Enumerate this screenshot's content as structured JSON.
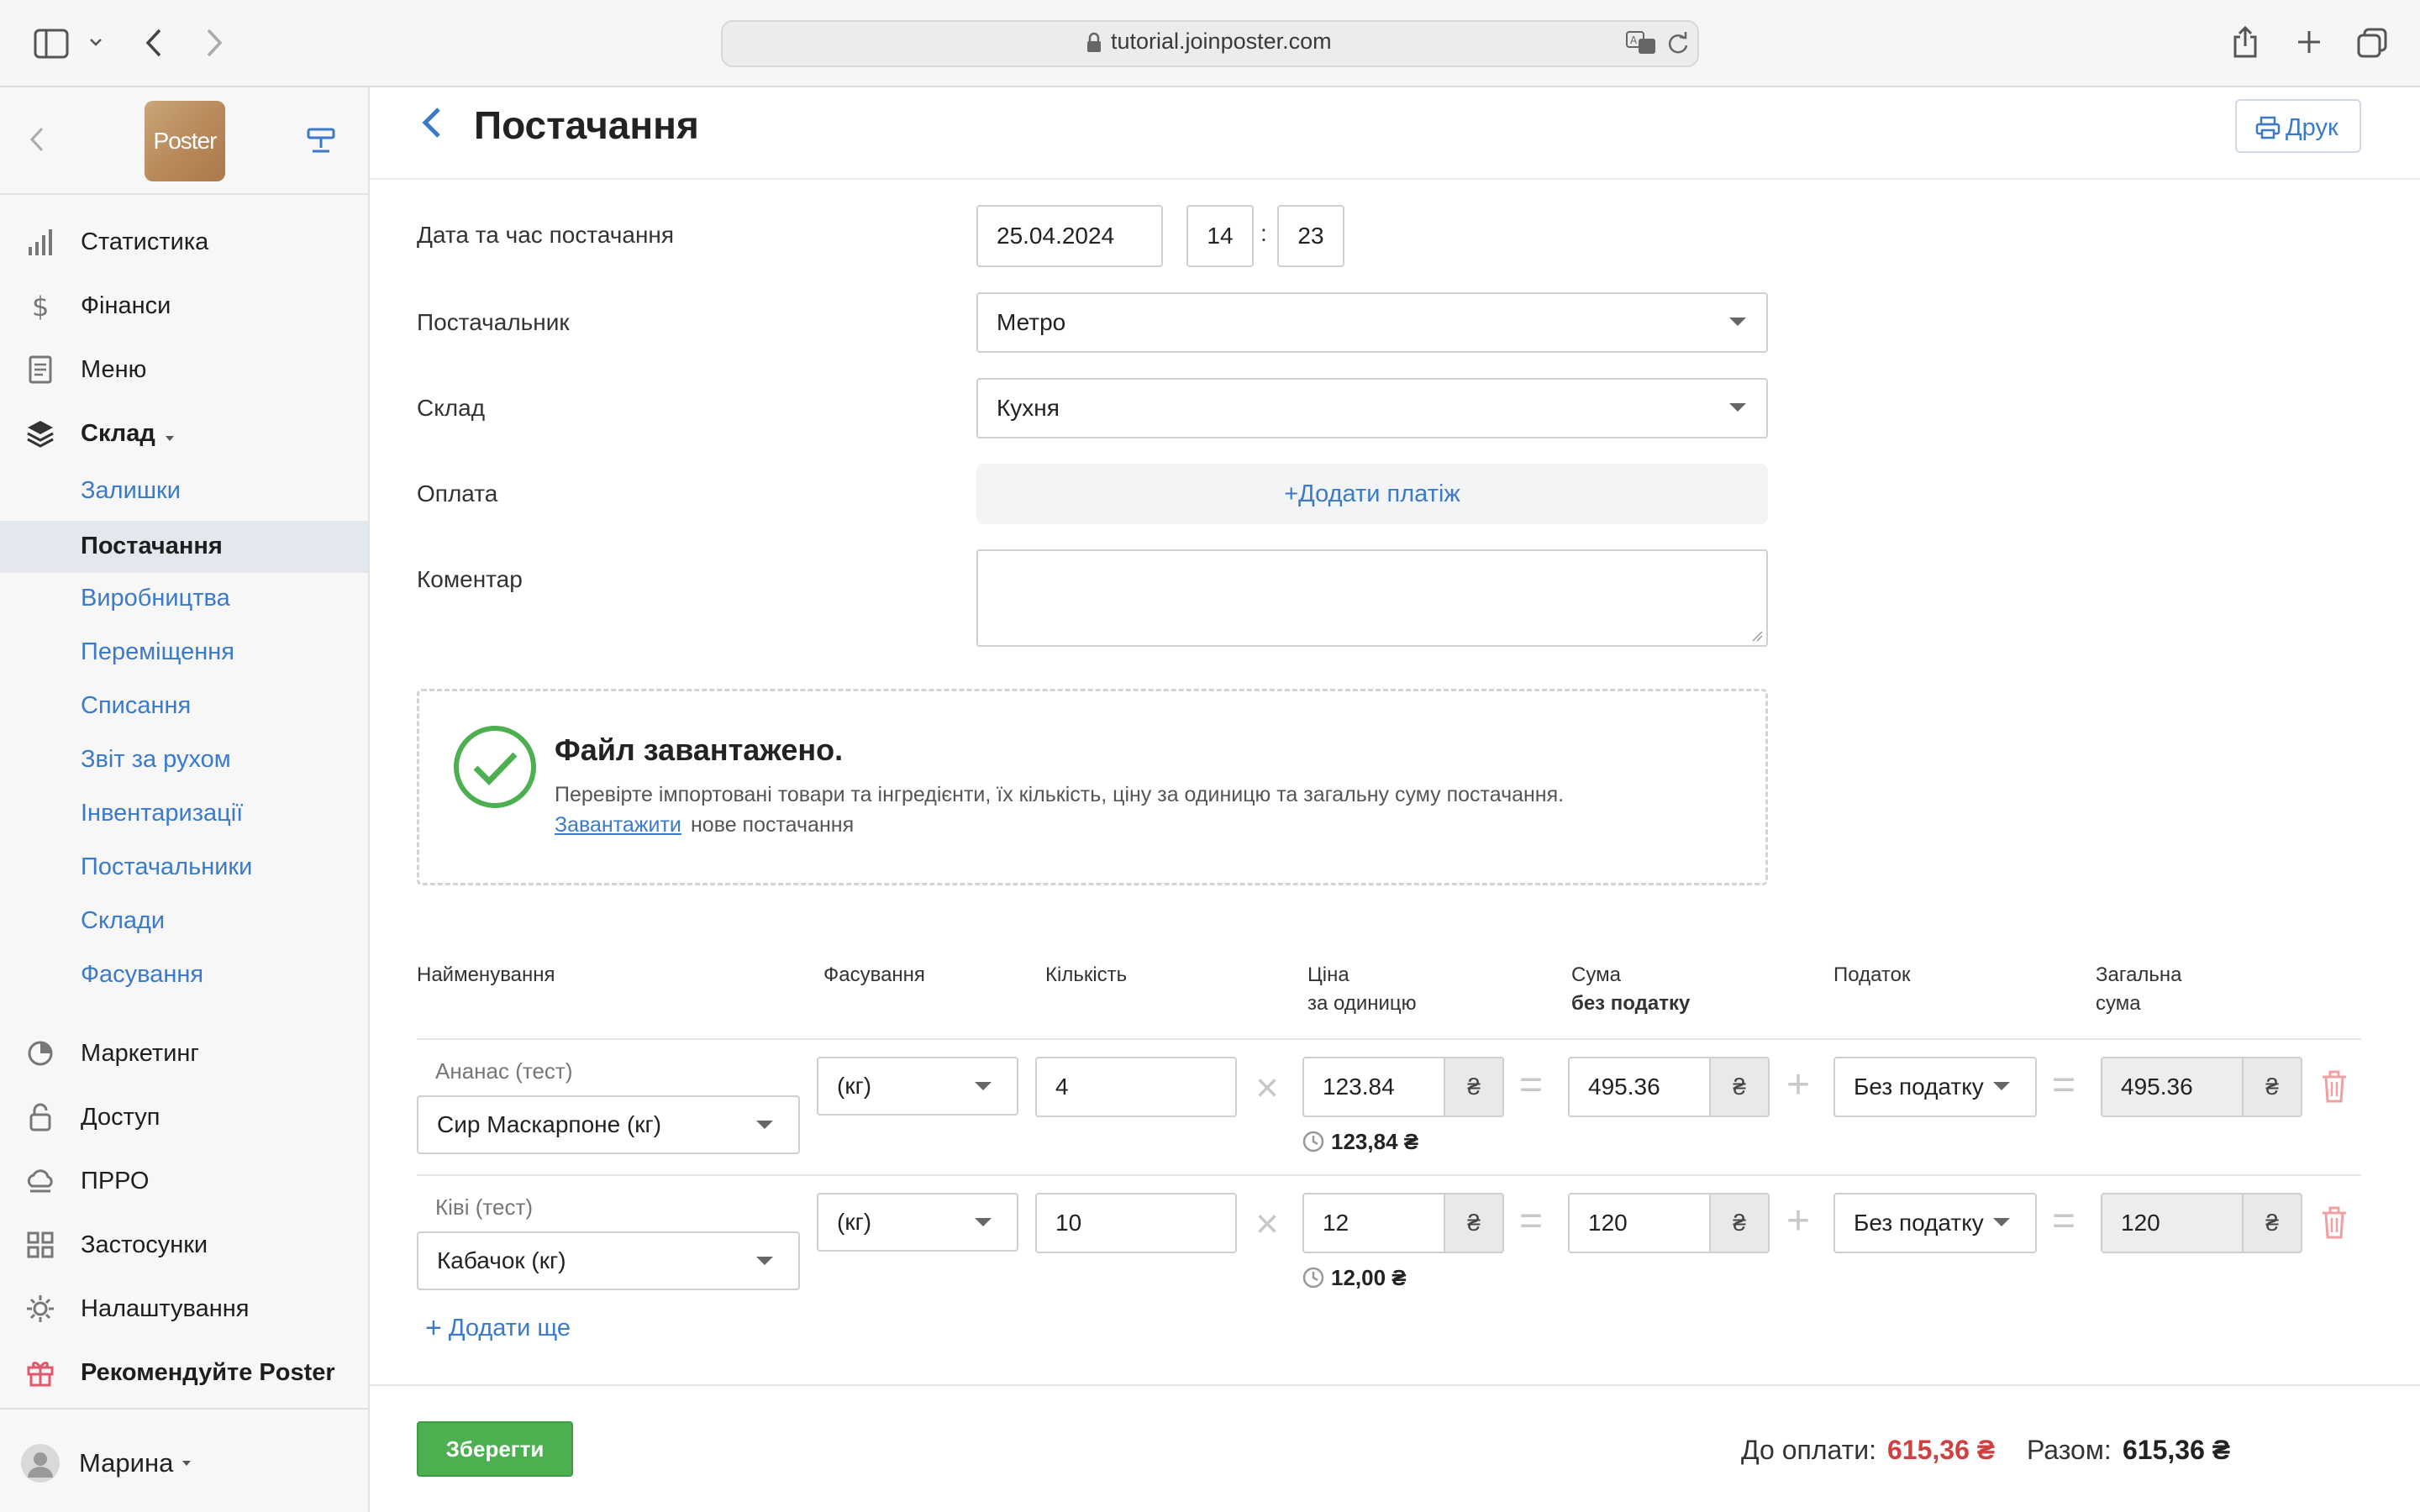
{
  "browser": {
    "url": "tutorial.joinposter.com"
  },
  "sidebar": {
    "logo_text": "Poster",
    "main_items": [
      {
        "label": "Статистика",
        "icon": "bar-chart-icon"
      },
      {
        "label": "Фінанси",
        "icon": "dollar-icon"
      },
      {
        "label": "Меню",
        "icon": "document-icon"
      },
      {
        "label": "Склад",
        "icon": "layers-icon"
      }
    ],
    "sub_items": [
      {
        "label": "Залишки"
      },
      {
        "label": "Постачання",
        "active": true
      },
      {
        "label": "Виробництва"
      },
      {
        "label": "Переміщення"
      },
      {
        "label": "Списання"
      },
      {
        "label": "Звіт за рухом"
      },
      {
        "label": "Інвентаризації"
      },
      {
        "label": "Постачальники"
      },
      {
        "label": "Склади"
      },
      {
        "label": "Фасування"
      }
    ],
    "bottom_items": [
      {
        "label": "Маркетинг",
        "icon": "marketing-icon"
      },
      {
        "label": "Доступ",
        "icon": "lock-icon"
      },
      {
        "label": "ПРРО",
        "icon": "cloud-icon"
      },
      {
        "label": "Застосунки",
        "icon": "grid-icon"
      },
      {
        "label": "Налаштування",
        "icon": "gear-icon"
      },
      {
        "label": "Рекомендуйте Poster",
        "icon": "gift-icon"
      }
    ],
    "user_name": "Марина"
  },
  "header": {
    "title": "Постачання",
    "print_label": "Друк"
  },
  "form": {
    "date_label": "Дата та час постачання",
    "date_value": "25.04.2024",
    "hour_value": "14",
    "time_separator": ":",
    "minute_value": "23",
    "supplier_label": "Постачальник",
    "supplier_value": "Метро",
    "warehouse_label": "Склад",
    "warehouse_value": "Кухня",
    "payment_label": "Оплата",
    "add_payment_label": "+Додати платіж",
    "comment_label": "Коментар",
    "comment_value": ""
  },
  "file_notice": {
    "title": "Файл завантажено.",
    "description": "Перевірте імпортовані товари та інгредієнти, їх кількість, ціну за одиницю та загальну суму постачання.",
    "link_text": "Завантажити",
    "rest_text": "нове постачання"
  },
  "table": {
    "headers": {
      "name": "Найменування",
      "packing": "Фасування",
      "quantity": "Кількість",
      "price_line1": "Ціна",
      "price_line2": "за одиницю",
      "sum_line1": "Сума",
      "sum_line2": "без податку",
      "tax": "Податок",
      "total_line1": "Загальна",
      "total_line2": "сума"
    },
    "currency": "₴",
    "rows": [
      {
        "source_name": "Ананас (тест)",
        "item": "Сир Маскарпоне (кг)",
        "packing": "(кг)",
        "quantity": "4",
        "price": "123.84",
        "price_note": "123,84 ₴",
        "sum": "495.36",
        "tax": "Без податку",
        "total": "495.36"
      },
      {
        "source_name": "Ківі (тест)",
        "item": "Кабачок (кг)",
        "packing": "(кг)",
        "quantity": "10",
        "price": "12",
        "price_note": "12,00 ₴",
        "sum": "120",
        "tax": "Без податку",
        "total": "120"
      }
    ],
    "add_more_label": "Додати ще"
  },
  "footer": {
    "save_label": "Зберегти",
    "to_pay_label": "До оплати:",
    "to_pay_value": "615,36 ₴",
    "total_label": "Разом:",
    "total_value": "615,36 ₴"
  },
  "colors": {
    "accent": "#3b7ac9",
    "save": "#4caf50",
    "to_pay": "#d23f3f",
    "success": "#4caf50"
  }
}
